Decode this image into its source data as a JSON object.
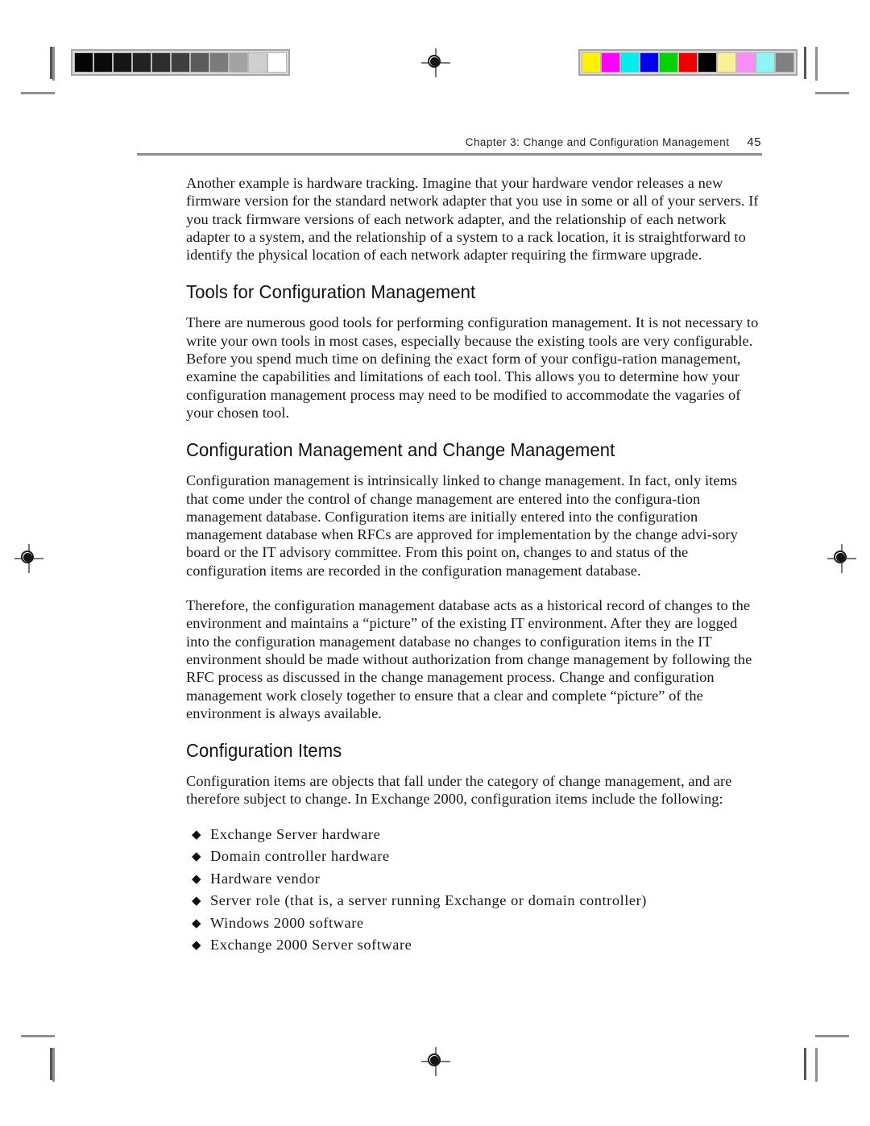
{
  "page": {
    "running_head": "Chapter 3: Change and Configuration Management",
    "folio": "45"
  },
  "content": {
    "paragraph_1": "Another example is hardware tracking. Imagine that your hardware vendor releases a new firmware version for the standard network adapter that you use in some or all of your servers. If you track firmware versions of each network adapter, and the relationship of each network adapter to a system, and the relationship of a system to a rack location, it is straightforward to identify the physical location of each network adapter requiring the firmware upgrade.",
    "heading_1": "Tools for Configuration Management",
    "paragraph_2": "There are numerous good tools for performing configuration management. It is not necessary to write your own tools in most cases, especially because the existing tools are very configurable. Before you spend much time on defining the exact form of your configu-ration management, examine the capabilities and limitations of each tool. This allows you to determine how your configuration management process may need to be modified to accommodate the vagaries of your chosen tool.",
    "heading_2": "Configuration Management and Change Management",
    "paragraph_3": "Configuration management is intrinsically linked to change management. In fact, only items that come under the control of change management are entered into the configura-tion management database. Configuration items are initially entered into the configuration management database when RFCs are approved for implementation by the change advi-sory board or the IT advisory committee. From this point on, changes to and status of the configuration items are recorded in the configuration management database.",
    "paragraph_4": "Therefore, the configuration management database acts as a historical record of changes to the environment and maintains a “picture” of the existing IT environment. After they are logged into the configuration management database no changes to configuration items in the IT environment should be made without authorization from change management by following the RFC process as discussed in the change management process. Change and configuration management work closely together to ensure that a clear and complete “picture” of the environment is always available.",
    "heading_3": "Configuration Items",
    "paragraph_5": "Configuration items are objects that fall under the category of change management, and are therefore subject to change. In Exchange 2000, configuration items include the following:",
    "bullet_symbol": "◆",
    "bullets": [
      "Exchange Server hardware",
      "Domain controller hardware",
      "Hardware vendor",
      "Server role (that is, a server running Exchange or domain controller)",
      "Windows 2000 software",
      "Exchange 2000 Server software"
    ]
  },
  "prepress": {
    "grayscale_strip": {
      "label": "grayscale-calibration-strip",
      "patches": [
        "#050505",
        "#0b0b0b",
        "#161616",
        "#222222",
        "#2d2d2d",
        "#3f3f3f",
        "#5a5a5a",
        "#7b7b7b",
        "#a2a2a2",
        "#cfcfcf",
        "#ffffff"
      ]
    },
    "color_strip": {
      "label": "color-calibration-strip",
      "patches": [
        "#fff200",
        "#ff00ff",
        "#00eeee",
        "#0000ee",
        "#00d400",
        "#ee0000",
        "#000000",
        "#fbf093",
        "#fb8ef5",
        "#8df5f5",
        "#808080"
      ]
    },
    "registration_marks": [
      "top",
      "bottom",
      "left",
      "right"
    ],
    "crop_marks": [
      "top-left",
      "top-right",
      "bottom-left",
      "bottom-right"
    ]
  }
}
